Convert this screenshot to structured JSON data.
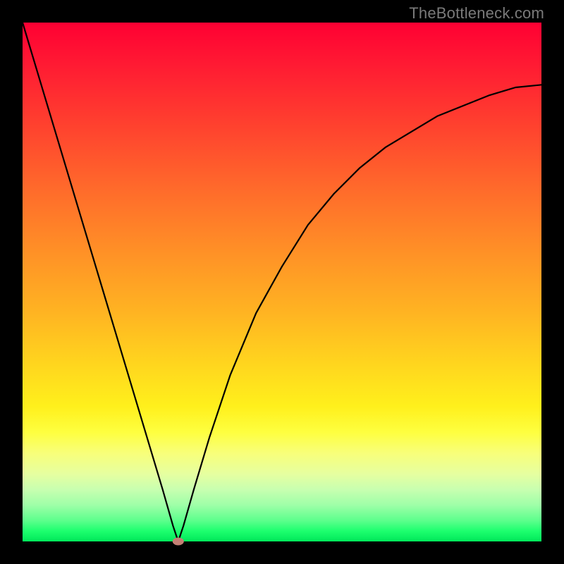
{
  "watermark": "TheBottleneck.com",
  "chart_data": {
    "type": "line",
    "title": "",
    "xlabel": "",
    "ylabel": "",
    "xlim": [
      0,
      100
    ],
    "ylim": [
      0,
      100
    ],
    "grid": false,
    "series": [
      {
        "name": "curve",
        "x": [
          0,
          3,
          6,
          9,
          12,
          15,
          18,
          21,
          24,
          27,
          29,
          30,
          31,
          33,
          36,
          40,
          45,
          50,
          55,
          60,
          65,
          70,
          75,
          80,
          85,
          90,
          95,
          100
        ],
        "y": [
          100,
          90,
          80,
          70,
          60,
          50,
          40,
          30,
          20,
          10,
          3,
          0,
          3,
          10,
          20,
          32,
          44,
          53,
          61,
          67,
          72,
          76,
          79,
          82,
          84,
          86,
          87.5,
          88
        ]
      }
    ],
    "marker": {
      "x": 30,
      "y": 0,
      "color": "#c47f74"
    }
  },
  "colors": {
    "curve_stroke": "#000000",
    "marker_fill": "#c47f74",
    "frame_bg": "#000000"
  }
}
